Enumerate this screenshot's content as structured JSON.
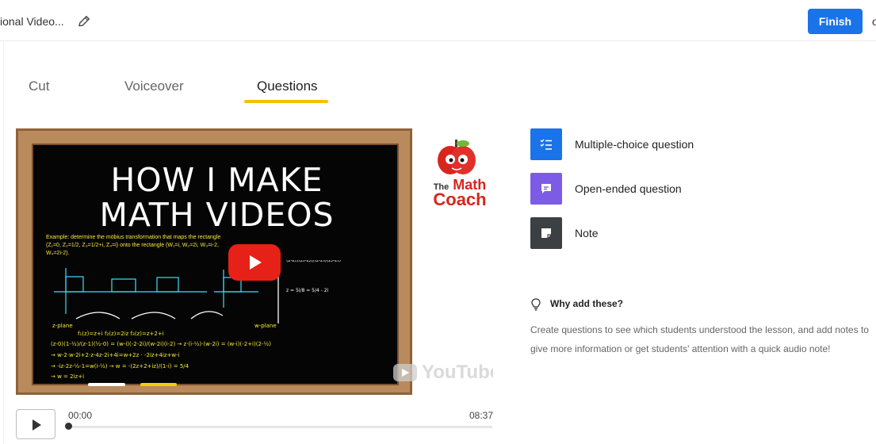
{
  "header": {
    "title": "ional Video...",
    "finish_label": "Finish",
    "right_edge_char": "o",
    "edit_icon": "pencil-icon"
  },
  "tabs": [
    {
      "label": "Cut",
      "active": false
    },
    {
      "label": "Voiceover",
      "active": false
    },
    {
      "label": "Questions",
      "active": true
    }
  ],
  "video": {
    "board_title_line1": "HOW I MAKE",
    "board_title_line2": "MATH VIDEOS",
    "example_text": "Example: determine the möbius transformation that maps the rectangle (Z₁=0, Z₂=1/2, Z₃=1/2+i, Z₄=i) onto the rectangle (W₁=i, W₂=2i, W₃=i-2, W₄=2i-2).",
    "channel_logo_line1": "The",
    "channel_logo_line2": "Math",
    "channel_logo_line3": "Coach",
    "platform_label": "YouTube",
    "play_icon": "youtube-play-icon"
  },
  "player": {
    "current_time": "00:00",
    "duration": "08:37",
    "progress": 0.0
  },
  "question_types": [
    {
      "label": "Multiple-choice question",
      "icon": "list-check-icon",
      "color": "#1a73e8"
    },
    {
      "label": "Open-ended question",
      "icon": "chat-icon",
      "color": "#7c5ce6"
    },
    {
      "label": "Note",
      "icon": "note-icon",
      "color": "#3d4043"
    }
  ],
  "info": {
    "title": "Why add these?",
    "icon": "lightbulb-icon",
    "body": "Create questions to see which students understood the lesson, and add notes to give more information or get students' attention with a quick audio note!"
  },
  "colors": {
    "finish_blue": "#1a73e8",
    "active_tab_underline": "#f5c000",
    "play_red": "#e62117"
  }
}
